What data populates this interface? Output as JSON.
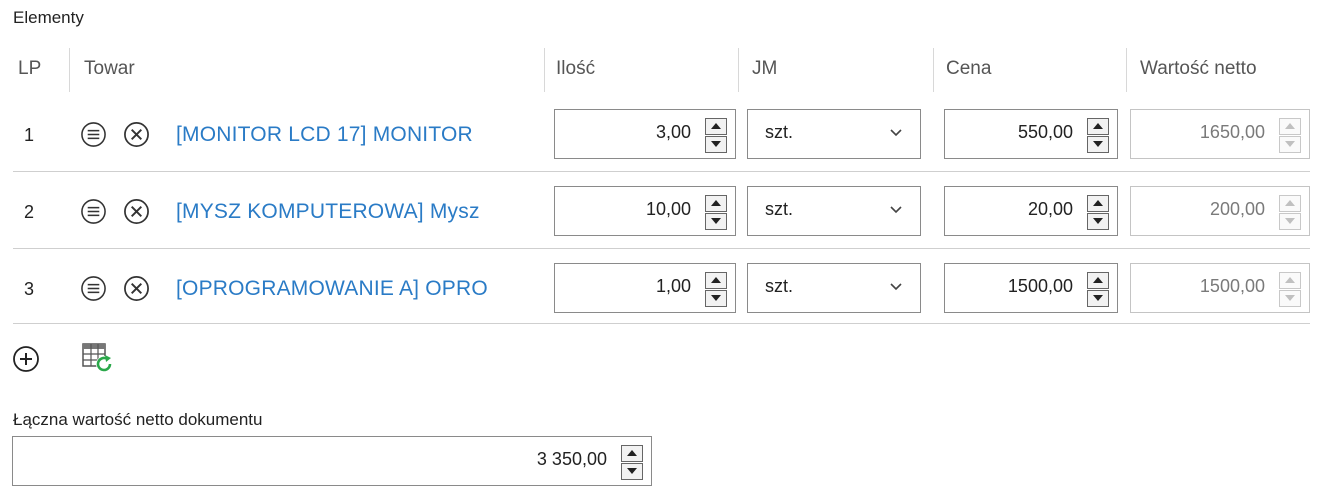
{
  "section": {
    "title": "Elementy"
  },
  "columns": {
    "lp": "LP",
    "towar": "Towar",
    "ilosc": "Ilość",
    "jm": "JM",
    "cena": "Cena",
    "wartosc": "Wartość netto"
  },
  "rows": [
    {
      "lp": "1",
      "towar": "[MONITOR LCD 17] MONITOR",
      "ilosc": "3,00",
      "jm": "szt.",
      "cena": "550,00",
      "wartosc": "1650,00"
    },
    {
      "lp": "2",
      "towar": "[MYSZ KOMPUTEROWA] Mysz",
      "ilosc": "10,00",
      "jm": "szt.",
      "cena": "20,00",
      "wartosc": "200,00"
    },
    {
      "lp": "3",
      "towar": "[OPROGRAMOWANIE A] OPRO",
      "ilosc": "1,00",
      "jm": "szt.",
      "cena": "1500,00",
      "wartosc": "1500,00"
    }
  ],
  "toolbar": {
    "add_icon": "add-circle-icon",
    "refresh_icon": "table-refresh-icon"
  },
  "total": {
    "label": "Łączna wartość netto dokumentu",
    "value": "3 350,00"
  },
  "colors": {
    "link": "#2a7bc6",
    "refresh_green": "#2aa84a"
  }
}
